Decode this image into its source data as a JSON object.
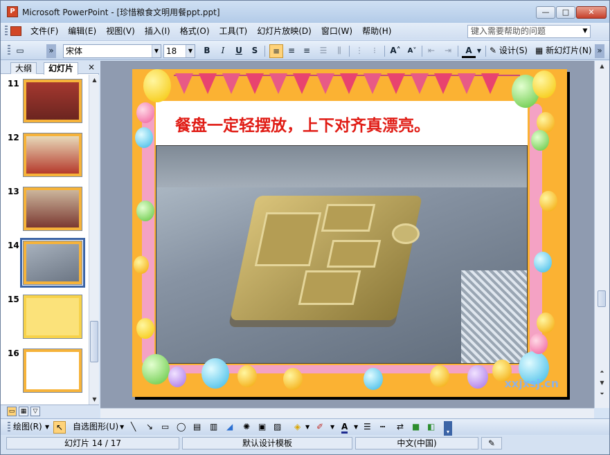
{
  "window": {
    "title": "Microsoft PowerPoint - [珍惜粮食文明用餐ppt.ppt]",
    "app_icon_letter": "P",
    "min_label": "—",
    "max_label": "□",
    "close_label": "✕"
  },
  "menu": {
    "items": [
      "文件(F)",
      "编辑(E)",
      "视图(V)",
      "插入(I)",
      "格式(O)",
      "工具(T)",
      "幻灯片放映(D)",
      "窗口(W)",
      "帮助(H)"
    ],
    "help_placeholder": "键入需要帮助的问题"
  },
  "toolbar": {
    "font_name": "宋体",
    "font_size": "18",
    "bold": "B",
    "italic": "I",
    "underline": "U",
    "shadow": "S",
    "design_label": "设计(S)",
    "new_slide_label": "新幻灯片(N)"
  },
  "pane": {
    "tab_outline": "大纲",
    "tab_slides": "幻灯片",
    "close": "×",
    "slide_numbers": [
      "11",
      "12",
      "13",
      "14",
      "15",
      "16"
    ],
    "selected": "14"
  },
  "slide": {
    "caption": "餐盘一定轻摆放，上下对齐真漂亮。",
    "watermark": "xxjxsj.cn"
  },
  "drawbar": {
    "draw_label": "绘图(R)",
    "autoshape_label": "自选图形(U)"
  },
  "status": {
    "slide_pos": "幻灯片 14 / 17",
    "template": "默认设计模板",
    "language": "中文(中国)"
  },
  "colors": {
    "accent": "#3b64a6",
    "slide_bg": "#fbb233",
    "caption_red": "#e01b14"
  }
}
